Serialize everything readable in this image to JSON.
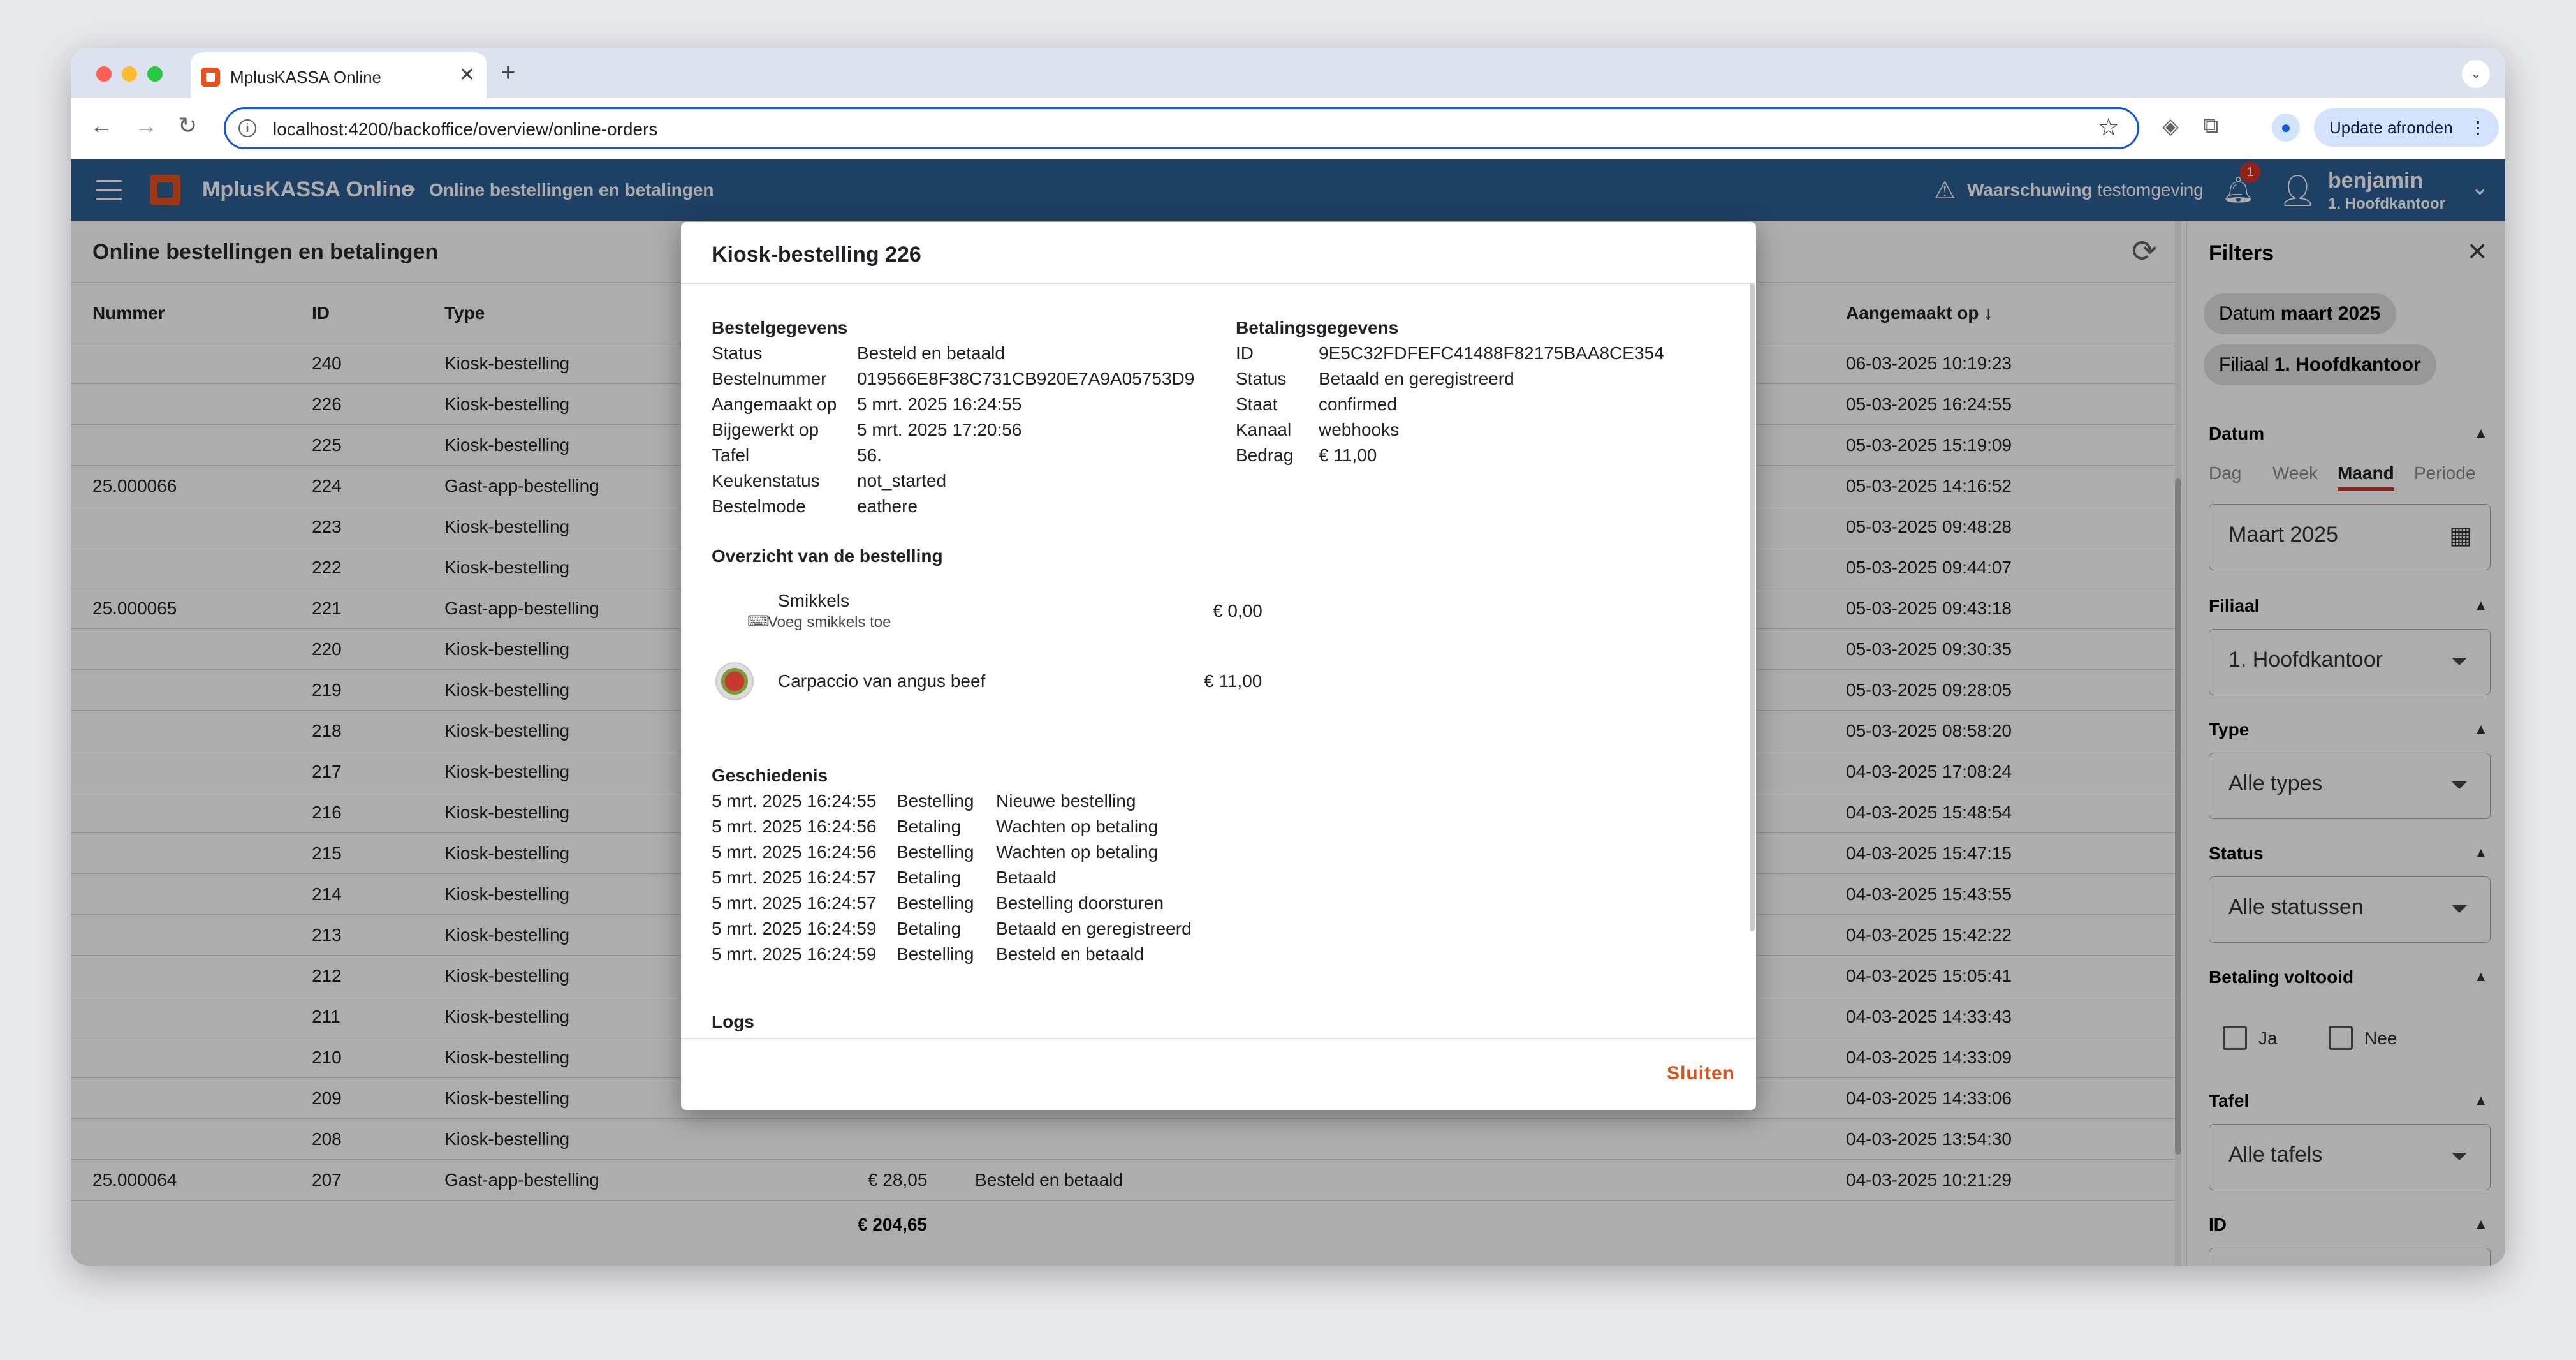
{
  "browser": {
    "tab_title": "MplusKASSA Online",
    "url": "localhost:4200/backoffice/overview/online-orders",
    "update_label": "Update afronden"
  },
  "app": {
    "brand": "MplusKASSA Online",
    "breadcrumb": "Online bestellingen en betalingen",
    "warning_bold": "Waarschuwing",
    "warning_text": "testomgeving",
    "notifications": "1",
    "user_name": "benjamin",
    "user_branch": "1. Hoofdkantoor"
  },
  "page": {
    "title": "Online bestellingen en betalingen",
    "columns": {
      "nummer": "Nummer",
      "id": "ID",
      "type": "Type",
      "created": "Aangemaakt op ↓"
    },
    "rows": [
      {
        "nummer": "",
        "id": "240",
        "type": "Kiosk-bestelling",
        "created": "06-03-2025 10:19:23"
      },
      {
        "nummer": "",
        "id": "226",
        "type": "Kiosk-bestelling",
        "created": "05-03-2025 16:24:55"
      },
      {
        "nummer": "",
        "id": "225",
        "type": "Kiosk-bestelling",
        "created": "05-03-2025 15:19:09"
      },
      {
        "nummer": "25.000066",
        "id": "224",
        "type": "Gast-app-bestelling",
        "created": "05-03-2025 14:16:52"
      },
      {
        "nummer": "",
        "id": "223",
        "type": "Kiosk-bestelling",
        "created": "05-03-2025 09:48:28"
      },
      {
        "nummer": "",
        "id": "222",
        "type": "Kiosk-bestelling",
        "created": "05-03-2025 09:44:07"
      },
      {
        "nummer": "25.000065",
        "id": "221",
        "type": "Gast-app-bestelling",
        "created": "05-03-2025 09:43:18"
      },
      {
        "nummer": "",
        "id": "220",
        "type": "Kiosk-bestelling",
        "created": "05-03-2025 09:30:35"
      },
      {
        "nummer": "",
        "id": "219",
        "type": "Kiosk-bestelling",
        "created": "05-03-2025 09:28:05"
      },
      {
        "nummer": "",
        "id": "218",
        "type": "Kiosk-bestelling",
        "created": "05-03-2025 08:58:20"
      },
      {
        "nummer": "",
        "id": "217",
        "type": "Kiosk-bestelling",
        "created": "04-03-2025 17:08:24"
      },
      {
        "nummer": "",
        "id": "216",
        "type": "Kiosk-bestelling",
        "created": "04-03-2025 15:48:54"
      },
      {
        "nummer": "",
        "id": "215",
        "type": "Kiosk-bestelling",
        "created": "04-03-2025 15:47:15"
      },
      {
        "nummer": "",
        "id": "214",
        "type": "Kiosk-bestelling",
        "created": "04-03-2025 15:43:55"
      },
      {
        "nummer": "",
        "id": "213",
        "type": "Kiosk-bestelling",
        "created": "04-03-2025 15:42:22"
      },
      {
        "nummer": "",
        "id": "212",
        "type": "Kiosk-bestelling",
        "created": "04-03-2025 15:05:41"
      },
      {
        "nummer": "",
        "id": "211",
        "type": "Kiosk-bestelling",
        "created": "04-03-2025 14:33:43"
      },
      {
        "nummer": "",
        "id": "210",
        "type": "Kiosk-bestelling",
        "created": "04-03-2025 14:33:09"
      },
      {
        "nummer": "",
        "id": "209",
        "type": "Kiosk-bestelling",
        "created": "04-03-2025 14:33:06"
      },
      {
        "nummer": "",
        "id": "208",
        "type": "Kiosk-bestelling",
        "created": "04-03-2025 13:54:30"
      },
      {
        "nummer": "25.000064",
        "id": "207",
        "type": "Gast-app-bestelling",
        "created": "04-03-2025 10:21:29",
        "amount": "€ 28,05",
        "status": "Besteld en betaald"
      }
    ],
    "total": "€ 204,65"
  },
  "filters": {
    "title": "Filters",
    "chip_date_label": "Datum",
    "chip_date_value": "maart 2025",
    "chip_branch_label": "Filiaal",
    "chip_branch_value": "1. Hoofdkantoor",
    "sec_date": "Datum",
    "seg_day": "Dag",
    "seg_week": "Week",
    "seg_month": "Maand",
    "seg_period": "Periode",
    "month_value": "Maart 2025",
    "sec_branch": "Filiaal",
    "branch_value": "1. Hoofdkantoor",
    "sec_type": "Type",
    "type_value": "Alle types",
    "sec_status": "Status",
    "status_value": "Alle statussen",
    "sec_payment": "Betaling voltooid",
    "yes": "Ja",
    "no": "Nee",
    "sec_table": "Tafel",
    "table_value": "Alle tafels",
    "sec_id": "ID"
  },
  "modal": {
    "title": "Kiosk-bestelling 226",
    "order_heading": "Bestelgegevens",
    "order": [
      {
        "k": "Status",
        "v": "Besteld en betaald"
      },
      {
        "k": "Bestelnummer",
        "v": "019566E8F38C731CB920E7A9A05753D9"
      },
      {
        "k": "Aangemaakt op",
        "v": "5 mrt. 2025 16:24:55"
      },
      {
        "k": "Bijgewerkt op",
        "v": "5 mrt. 2025 17:20:56"
      },
      {
        "k": "Tafel",
        "v": "56."
      },
      {
        "k": "Keukenstatus",
        "v": "not_started"
      },
      {
        "k": "Bestelmode",
        "v": "eathere"
      }
    ],
    "payment_heading": "Betalingsgegevens",
    "payment": [
      {
        "k": "ID",
        "v": "9E5C32FDFEFC41488F82175BAA8CE354"
      },
      {
        "k": "Status",
        "v": "Betaald en geregistreerd"
      },
      {
        "k": "Staat",
        "v": "confirmed"
      },
      {
        "k": "Kanaal",
        "v": "webhooks"
      },
      {
        "k": "Bedrag",
        "v": "€ 11,00"
      }
    ],
    "overview_heading": "Overzicht van de bestelling",
    "items": [
      {
        "name": "Smikkels",
        "price": "€ 0,00",
        "action": "Voeg smikkels toe"
      },
      {
        "name": "Carpaccio van angus beef",
        "price": "€ 11,00"
      }
    ],
    "history_heading": "Geschiedenis",
    "history": [
      {
        "t": "5 mrt. 2025 16:24:55",
        "c": "Bestelling",
        "d": "Nieuwe bestelling"
      },
      {
        "t": "5 mrt. 2025 16:24:56",
        "c": "Betaling",
        "d": "Wachten op betaling"
      },
      {
        "t": "5 mrt. 2025 16:24:56",
        "c": "Bestelling",
        "d": "Wachten op betaling"
      },
      {
        "t": "5 mrt. 2025 16:24:57",
        "c": "Betaling",
        "d": "Betaald"
      },
      {
        "t": "5 mrt. 2025 16:24:57",
        "c": "Bestelling",
        "d": "Bestelling doorsturen"
      },
      {
        "t": "5 mrt. 2025 16:24:59",
        "c": "Betaling",
        "d": "Betaald en geregistreerd"
      },
      {
        "t": "5 mrt. 2025 16:24:59",
        "c": "Bestelling",
        "d": "Besteld en betaald"
      }
    ],
    "logs_heading": "Logs",
    "close_label": "Sluiten"
  }
}
